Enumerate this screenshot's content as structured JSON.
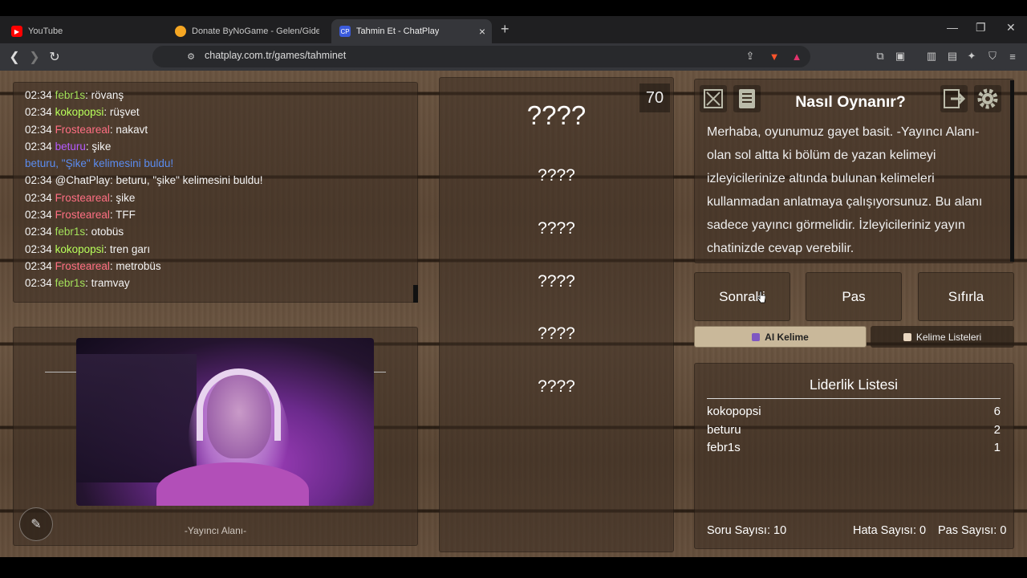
{
  "browser": {
    "tabs": [
      {
        "title": "YouTube",
        "icon": "youtube-icon",
        "color": "#ff0000"
      },
      {
        "title": "Donate ByNoGame - Gelen/Giden Ba",
        "icon": "bynogame-icon",
        "color": "#f5a623"
      },
      {
        "title": "Tahmin Et - ChatPlay",
        "icon": "chatplay-icon",
        "favicon_text": "CP",
        "color": "#3b5bdb"
      }
    ],
    "url": "chatplay.com.tr/games/tahminet"
  },
  "chat": {
    "messages": [
      {
        "time": "02:34",
        "user": "febr1s",
        "color": "#a3e05a",
        "text": ": rövanş"
      },
      {
        "time": "02:34",
        "user": "kokopopsi",
        "color": "#b8ff5a",
        "text": ": rüşvet"
      },
      {
        "time": "02:34",
        "user": "Frostearеal",
        "color": "#ff6f83",
        "text": ": nakavt"
      },
      {
        "time": "02:34",
        "user": "beturu",
        "color": "#b65bff",
        "text": ": şike"
      },
      {
        "notice": "beturu, \"Şike\" kelimesini buldu!"
      },
      {
        "time": "02:34",
        "user": "@ChatPlay",
        "color": "#f4f4f4",
        "text": ": beturu, \"şike\" kelimesini buldu!"
      },
      {
        "time": "02:34",
        "user": "Frostearеal",
        "color": "#ff6f83",
        "text": ": şike"
      },
      {
        "time": "02:34",
        "user": "Frostearеal",
        "color": "#ff6f83",
        "text": ": TFF"
      },
      {
        "time": "02:34",
        "user": "febr1s",
        "color": "#a3e05a",
        "text": ": otobüs"
      },
      {
        "time": "02:34",
        "user": "kokopopsi",
        "color": "#b8ff5a",
        "text": ": tren garı"
      },
      {
        "time": "02:34",
        "user": "Frostearеal",
        "color": "#ff6f83",
        "text": ": metrobüs"
      },
      {
        "time": "02:34",
        "user": "febr1s",
        "color": "#a3e05a",
        "text": ": tramvay"
      }
    ]
  },
  "streamer": {
    "label": "-Yayıncı Alanı-"
  },
  "words": {
    "counter": "70",
    "main": "????",
    "list": [
      "????",
      "????",
      "????",
      "????",
      "????"
    ]
  },
  "howto": {
    "title": "Nasıl Oynanır?",
    "text": "Merhaba, oyunumuz gayet basit. -Yayıncı Alanı- olan sol altta ki bölüm de yazan kelimeyi izleyicilerinize altında bulunan kelimeleri kullanmadan anlatmaya çalışıyorsunuz. Bu alanı sadece yayıncı görmelidir. İzleyicileriniz yayın chatinizde cevap verebilir."
  },
  "controls": {
    "next": "Sonraki",
    "pass": "Pas",
    "reset": "Sıfırla",
    "ai_word": "AI Kelime",
    "word_lists": "Kelime Listeleri"
  },
  "leaderboard": {
    "title": "Liderlik Listesi",
    "rows": [
      {
        "name": "kokopopsi",
        "score": "6"
      },
      {
        "name": "beturu",
        "score": "2"
      },
      {
        "name": "febr1s",
        "score": "1"
      }
    ],
    "questions": "Soru Sayısı: 10",
    "errors": "Hata Sayısı: 0",
    "passes": "Pas Sayısı: 0"
  }
}
